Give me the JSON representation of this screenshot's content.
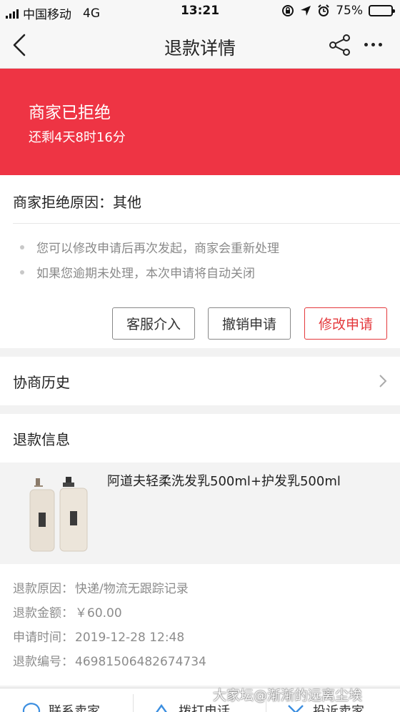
{
  "status_bar": {
    "carrier": "中国移动",
    "network": "4G",
    "time": "13:21",
    "battery": "75%",
    "battery_level": 0.75
  },
  "nav": {
    "title": "退款详情"
  },
  "banner": {
    "status": "商家已拒绝",
    "countdown": "还剩4天8时16分",
    "color": "#ee3444"
  },
  "rejection": {
    "reason": "商家拒绝原因：其他",
    "tips": [
      "您可以修改申请后再次发起，商家会重新处理",
      "如果您逾期未处理，本次申请将自动关闭"
    ],
    "buttons": {
      "service": "客服介入",
      "cancel": "撤销申请",
      "modify": "修改申请"
    }
  },
  "history": {
    "label": "协商历史"
  },
  "refund_info": {
    "header": "退款信息",
    "product_name": "阿道夫轻柔洗发乳500ml+护发乳500ml",
    "rows": [
      {
        "label": "退款原因：",
        "value": "快递/物流无跟踪记录"
      },
      {
        "label": "退款金额：",
        "value": "￥60.00"
      },
      {
        "label": "申请时间：",
        "value": "2019-12-28 12:48"
      },
      {
        "label": "退款编号：",
        "value": "46981506482674734"
      }
    ]
  },
  "bottom_bar": {
    "item1": "联系卖家",
    "item2": "拨打电话",
    "item3": "投诉卖家"
  },
  "watermark": "大家坛@渐渐的远离尘埃"
}
